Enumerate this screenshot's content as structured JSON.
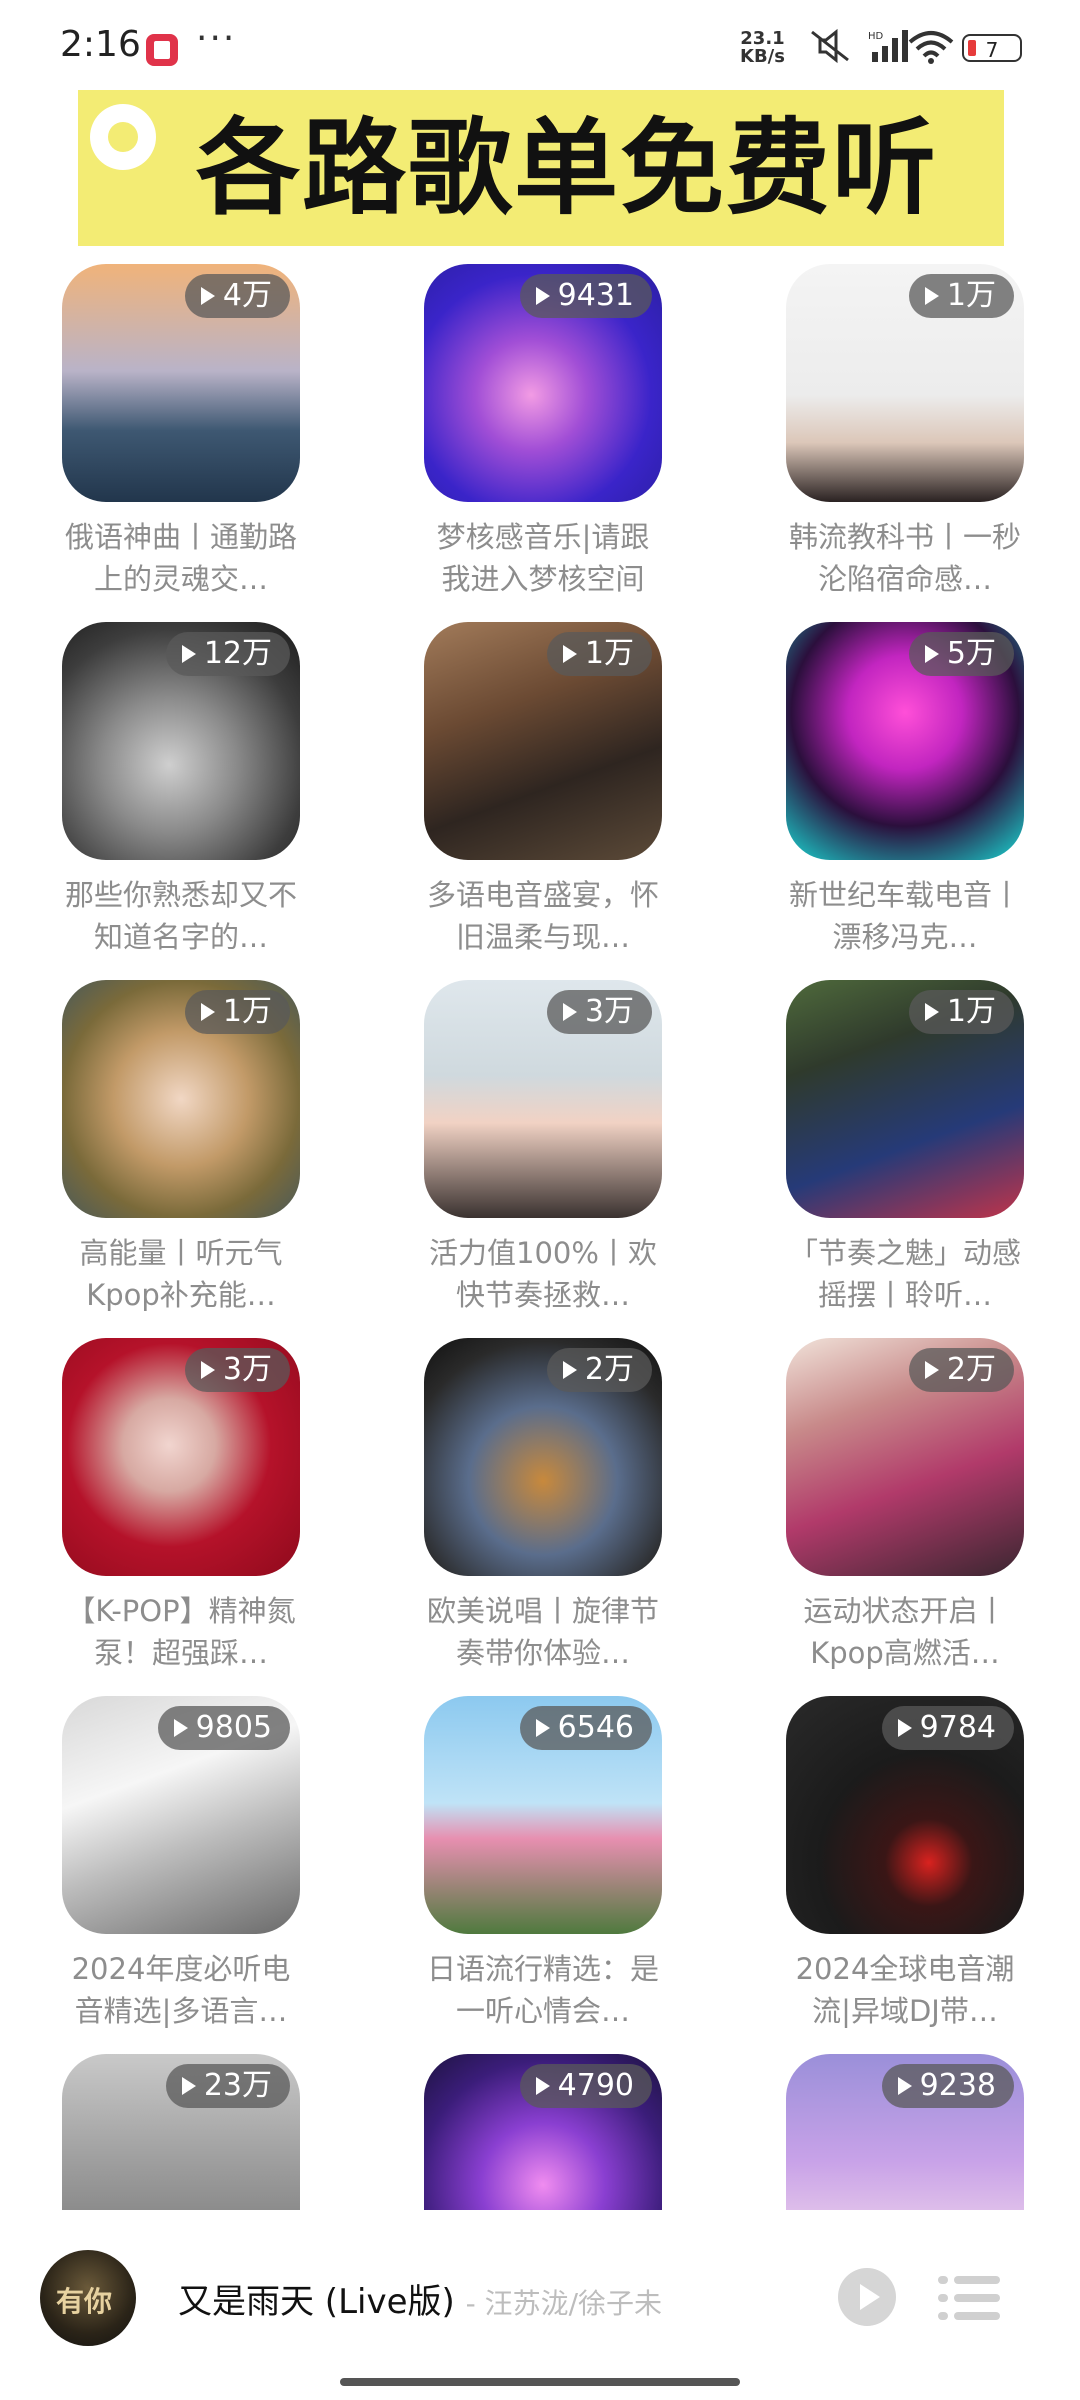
{
  "status_bar": {
    "time": "2:16",
    "more": "···",
    "net_speed_value": "23.1",
    "net_speed_unit": "KB/s",
    "battery": "7",
    "icons": [
      "app-notification-icon",
      "mute-icon",
      "signal-icon",
      "wifi-icon",
      "battery-icon"
    ]
  },
  "banner": {
    "title": "各路歌单免费听"
  },
  "playlists": [
    {
      "count": "4万",
      "title": "俄语神曲丨通勤路上的灵魂交…",
      "art": "linear-gradient(180deg,#f0b37a 0%,#b9b3c8 45%,#3e5872 70%,#22364c 100%)"
    },
    {
      "count": "9431",
      "title": "梦核感音乐|请跟我进入梦核空间",
      "art": "radial-gradient(circle at 45% 55%,#f29be4 0%,#a14ed6 30%,#3a24c9 65%,#2a1fa0 100%)"
    },
    {
      "count": "1万",
      "title": "韩流教科书丨一秒沦陷宿命感…",
      "art": "linear-gradient(180deg,#f4f4f4 0%,#ececec 55%,#dcc7b9 75%,#2a2222 100%)"
    },
    {
      "count": "12万",
      "title": "那些你熟悉却又不知道名字的…",
      "art": "radial-gradient(circle at 45% 60%,#cfcfcf 0%,#8a8a8a 35%,#3d3d3d 70%,#1a1a1a 100%)"
    },
    {
      "count": "1万",
      "title": "多语电音盛宴，怀旧温柔与现…",
      "art": "linear-gradient(160deg,#a27b5a 0%,#6b4a33 35%,#2e2520 65%,#5c4a38 100%)"
    },
    {
      "count": "5万",
      "title": "新世纪车载电音丨漂移冯克…",
      "art": "radial-gradient(circle at 50% 38%,#ff4fd8 0%,#c225c0 30%,#2b0f3c 60%,#1ad7d2 100%)"
    },
    {
      "count": "1万",
      "title": "高能量丨听元气Kpop补充能…",
      "art": "radial-gradient(circle at 50% 50%,#f1d7c4 0%,#c29a68 40%,#7a6a3a 70%,#4a5a5a 100%)"
    },
    {
      "count": "3万",
      "title": "活力值100%丨欢快节奏拯救…",
      "art": "linear-gradient(180deg,#dfe7ec 0%,#cfd9de 40%,#f1d2c4 60%,#3a3230 100%)"
    },
    {
      "count": "1万",
      "title": "「节奏之魅」动感摇摆丨聆听…",
      "art": "linear-gradient(160deg,#4f6a3c 0%,#2f3a2c 30%,#263a78 65%,#c0344a 100%)"
    },
    {
      "count": "3万",
      "title": "【K-POP】精神氮泵！超强踩…",
      "art": "radial-gradient(circle at 45% 45%,#f1d5cf 0%,#d7a9a2 25%,#b5122a 55%,#8f0a1c 100%)"
    },
    {
      "count": "2万",
      "title": "欧美说唱丨旋律节奏带你体验…",
      "art": "radial-gradient(circle at 50% 60%,#c8893c 0%,#5a6d8c 40%,#2a2a2a 75%,#111 100%)"
    },
    {
      "count": "2万",
      "title": "运动状态开启丨Kpop高燃活…",
      "art": "linear-gradient(160deg,#f1e3da 0%,#c88a8a 30%,#b13a6a 60%,#3a2630 100%)"
    },
    {
      "count": "9805",
      "title": "2024年度必听电音精选|多语言…",
      "art": "linear-gradient(160deg,#d8d8d8 0%,#f6f6f6 35%,#bdbdbd 60%,#6a6a6a 100%)"
    },
    {
      "count": "6546",
      "title": "日语流行精选：是一听心情会…",
      "art": "linear-gradient(180deg,#8cc9ef 0%,#bfe3f7 45%,#e78fb0 60%,#4f7a3e 100%)"
    },
    {
      "count": "9784",
      "title": "2024全球电音潮流|异域DJ带…",
      "art": "radial-gradient(circle at 60% 70%,#d9221f 0%,#3a1616 20%,#1b1b1b 50%,#2a2a2a 100%)"
    },
    {
      "count": "23万",
      "title": "",
      "art": "linear-gradient(180deg,#c9c9c9 0%,#9a9a9a 50%,#6d6d6d 100%)"
    },
    {
      "count": "4790",
      "title": "",
      "art": "radial-gradient(circle at 50% 55%,#f08cf0 0%,#8a3fd1 35%,#3b1d7a 70%,#1d1340 100%)"
    },
    {
      "count": "9238",
      "title": "",
      "art": "linear-gradient(180deg,#9a8fd9 0%,#c8a2e8 45%,#e2c3ea 70%,#9d7ac0 100%)"
    }
  ],
  "player": {
    "song": "又是雨天 (Live版)",
    "artist": "- 汪苏泷/徐子未",
    "cover_text": "有你"
  }
}
